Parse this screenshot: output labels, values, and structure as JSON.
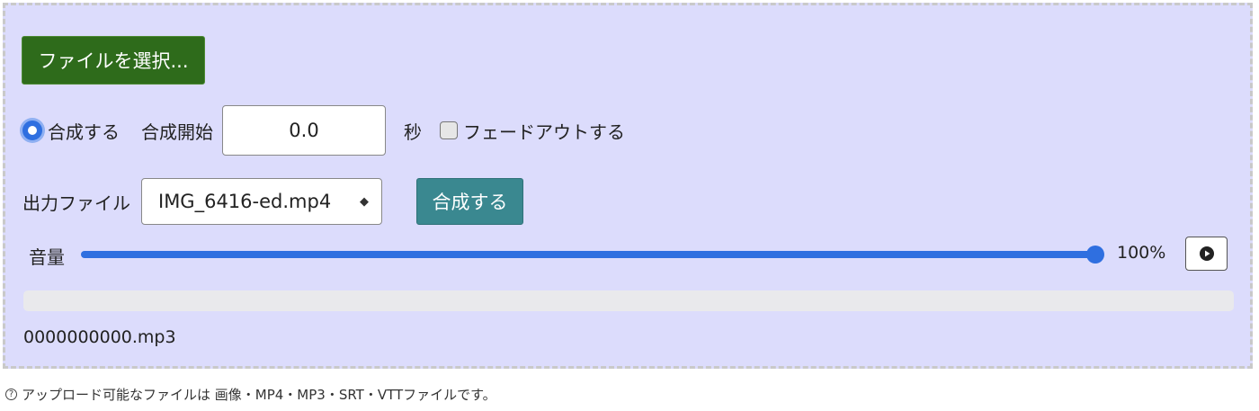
{
  "upload": {
    "file_button_label": "ファイルを選択..."
  },
  "compose": {
    "radio_label": "合成する",
    "start_label": "合成開始",
    "start_value": "0.0",
    "seconds_unit": "秒",
    "fade_label": "フェードアウトする",
    "fade_checked": false
  },
  "output": {
    "label": "出力ファイル",
    "selected_file": "IMG_6416-ed.mp4",
    "compose_button_label": "合成する"
  },
  "volume": {
    "label": "音量",
    "value_percent": 100,
    "display": "100%"
  },
  "audio": {
    "file_name": "0000000000.mp3",
    "progress": 0
  },
  "footer": {
    "help_icon": "?",
    "text": "アップロード可能なファイルは 画像・MP4・MP3・SRT・VTTファイルです。"
  },
  "colors": {
    "panel_bg": "#dcdcfc",
    "file_button": "#2e6b1b",
    "compose_button": "#3a8890",
    "accent": "#2f6fe0"
  }
}
